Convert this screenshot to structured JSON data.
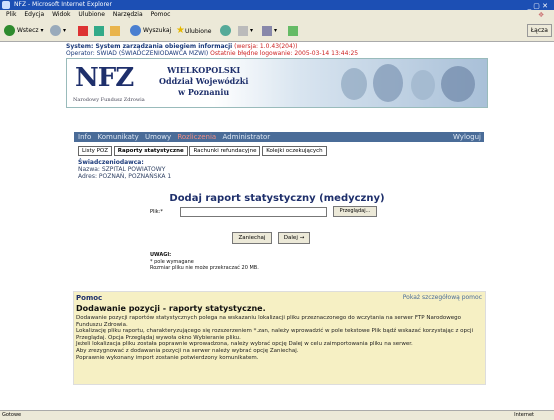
{
  "window": {
    "title": "NFZ - Microsoft Internet Explorer"
  },
  "menu": [
    "Plik",
    "Edycja",
    "Widok",
    "Ulubione",
    "Narzędzia",
    "Pomoc"
  ],
  "toolbar": {
    "back": "Wstecz",
    "search": "Wyszukaj",
    "favorites": "Ulubione",
    "links": "Łącza"
  },
  "system": {
    "title": "System: System zarządzania obiegiem informacji",
    "version": "(wersja: 1.0.43(204))",
    "operator": "Operator: SWIAD (ŚWIADCZENIODAWCA MZWI)",
    "lastlogin": "Ostatnie błędne logowanie: 2005-03-14 13:44:25"
  },
  "banner": {
    "logo": "NFZ",
    "sub": "Narodowy Fundusz Zdrowia",
    "line1": "WIELKOPOLSKI",
    "line2": "Oddział Wojewódzki",
    "line3": "w Poznaniu"
  },
  "nav": {
    "items": [
      "Info",
      "Komunikaty",
      "Umowy",
      "Rozliczenia",
      "Administrator"
    ],
    "logout": "Wyloguj"
  },
  "tabs": [
    "Listy POZ",
    "Raporty statystyczne",
    "Rachunki refundacyjne",
    "Kolejki oczekujących"
  ],
  "provider": {
    "header": "Świadczeniodawca:",
    "name": "Nazwa: SZPITAL POWIATOWY",
    "address": "Adres: POZNAŃ, POZNAŃSKA 1"
  },
  "form": {
    "title": "Dodaj raport statystyczny (medyczny)",
    "file_label": "Plik:*",
    "browse": "Przeglądaj...",
    "cancel": "Zaniechaj",
    "next": "Dalej →",
    "notes_title": "UWAGI:",
    "note1": "* pole wymagane",
    "note2": "Rozmiar pliku nie może przekraczać 20 MB."
  },
  "help": {
    "header": "Pomoc",
    "link": "Pokaż szczegółową pomoc",
    "title": "Dodawanie pozycji - raporty statystyczne.",
    "p1": "Dodawanie pozycji raportów statystycznych polega na wskazaniu lokalizacji pliku przeznaczonego do wczytania na serwer FTP Narodowego Funduszu Zdrowia.",
    "p2": "Lokalizację pliku raportu, charakteryzującego się rozszerzeniem *.zan, należy wprowadzić w pole tekstowe Plik bądź wskazać korzystając z opcji Przeglądaj. Opcja Przeglądaj wywoła okno Wybieranie pliku.",
    "p3": "Jeżeli lokalizacja pliku została poprawnie wprowadzona, należy wybrać opcję Dalej w celu zaimportowania pliku na serwer.",
    "p4": "Aby zrezygnować z dodawania pozycji na serwer należy wybrać opcję Zaniechaj.",
    "p5": "Poprawnie wykonany import zostanie potwierdzony komunikatem."
  },
  "status": {
    "left": "Gotowe",
    "right": "Internet"
  }
}
